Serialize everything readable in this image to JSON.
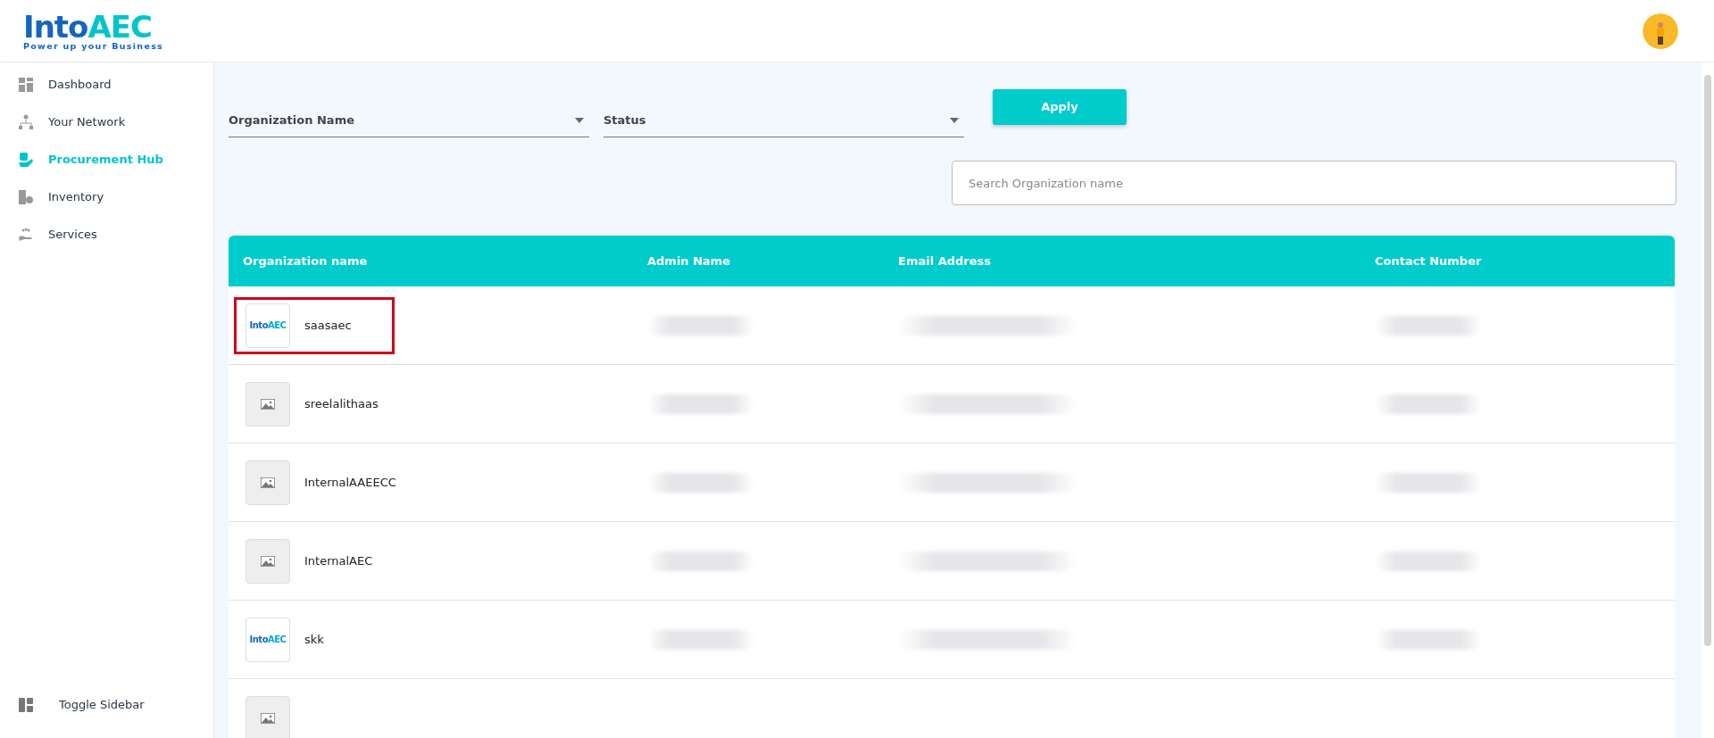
{
  "logo": {
    "word_a": "Into",
    "word_b": "AEC",
    "tagline": "Power up your Business"
  },
  "sidebar": {
    "items": [
      {
        "label": "Dashboard",
        "selected": false
      },
      {
        "label": "Your Network",
        "selected": false
      },
      {
        "label": "Procurement Hub",
        "selected": true
      },
      {
        "label": "Inventory",
        "selected": false
      },
      {
        "label": "Services",
        "selected": false
      }
    ],
    "toggle": "Toggle Sidebar"
  },
  "filters": {
    "selects": [
      {
        "placeholder": "Organization Name"
      },
      {
        "placeholder": "Status"
      }
    ],
    "apply": "Apply",
    "search": {
      "placeholder": "Search Organization name"
    }
  },
  "table": {
    "columns": [
      "Organization name",
      "Admin Name",
      "Email Address",
      "Contact Number"
    ],
    "rows": [
      {
        "avatar": {
          "kind": "logo",
          "word_a": "Into",
          "word_b": "AEC"
        },
        "name": "saasaec",
        "highlighted": true,
        "redacted": true
      },
      {
        "avatar": {
          "kind": "placeholder"
        },
        "name": "sreelalithaas",
        "highlighted": false,
        "redacted": true
      },
      {
        "avatar": {
          "kind": "placeholder"
        },
        "name": "InternalAAEECC",
        "highlighted": false,
        "redacted": true
      },
      {
        "avatar": {
          "kind": "placeholder"
        },
        "name": "InternalAEC",
        "highlighted": false,
        "redacted": true
      },
      {
        "avatar": {
          "kind": "logo",
          "word_a": "Into",
          "word_b": "AEC"
        },
        "name": "skk",
        "highlighted": false,
        "redacted": true
      },
      {
        "avatar": {
          "kind": "placeholder"
        },
        "highlighted": false,
        "redacted": false
      }
    ]
  }
}
